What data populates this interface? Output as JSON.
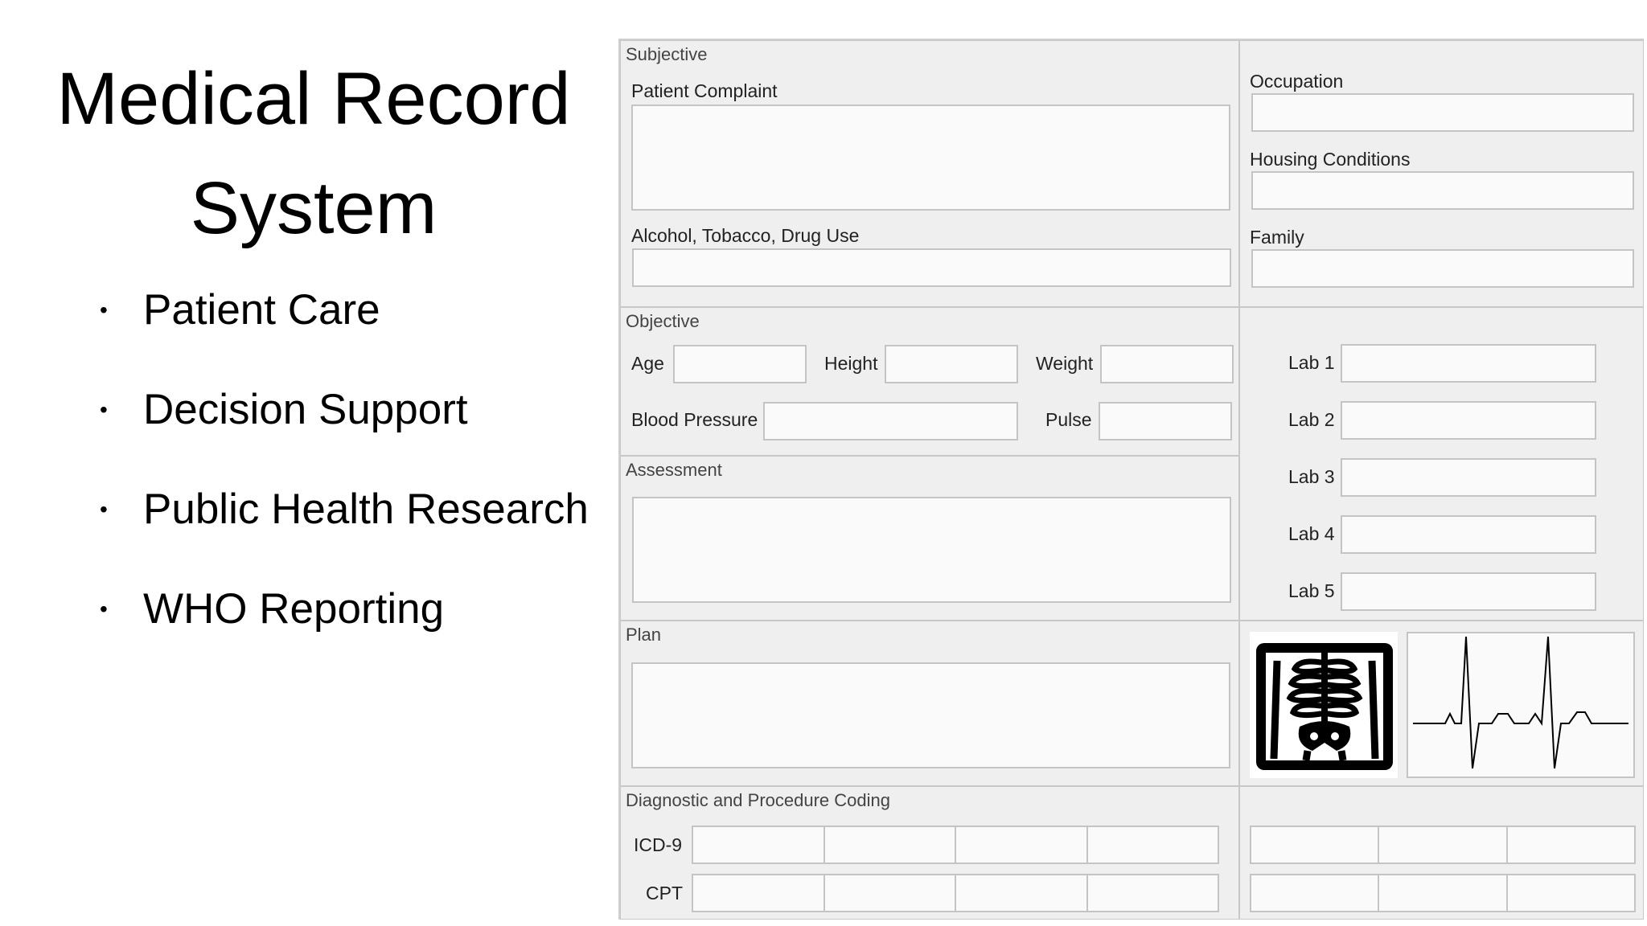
{
  "slide": {
    "title_line1": "Medical Record",
    "title_line2": "System",
    "bullets": [
      "Patient Care",
      "Decision Support",
      "Public Health Research",
      "WHO Reporting"
    ],
    "bullet_symbol": "•"
  },
  "form": {
    "subjective": {
      "title": "Subjective",
      "patient_complaint_label": "Patient Complaint",
      "substance_use_label": "Alcohol, Tobacco, Drug Use"
    },
    "social": {
      "occupation_label": "Occupation",
      "housing_label": "Housing Conditions",
      "family_label": "Family"
    },
    "objective": {
      "title": "Objective",
      "age_label": "Age",
      "height_label": "Height",
      "weight_label": "Weight",
      "bp_label": "Blood Pressure",
      "pulse_label": "Pulse"
    },
    "labs": {
      "lab1_label": "Lab 1",
      "lab2_label": "Lab 2",
      "lab3_label": "Lab 3",
      "lab4_label": "Lab 4",
      "lab5_label": "Lab 5"
    },
    "assessment": {
      "title": "Assessment"
    },
    "plan": {
      "title": "Plan"
    },
    "coding": {
      "title": "Diagnostic and Procedure Coding",
      "icd9_label": "ICD-9",
      "cpt_label": "CPT"
    },
    "images": {
      "xray_icon": "xray-chest-icon",
      "ecg_icon": "ecg-waveform-icon"
    }
  }
}
